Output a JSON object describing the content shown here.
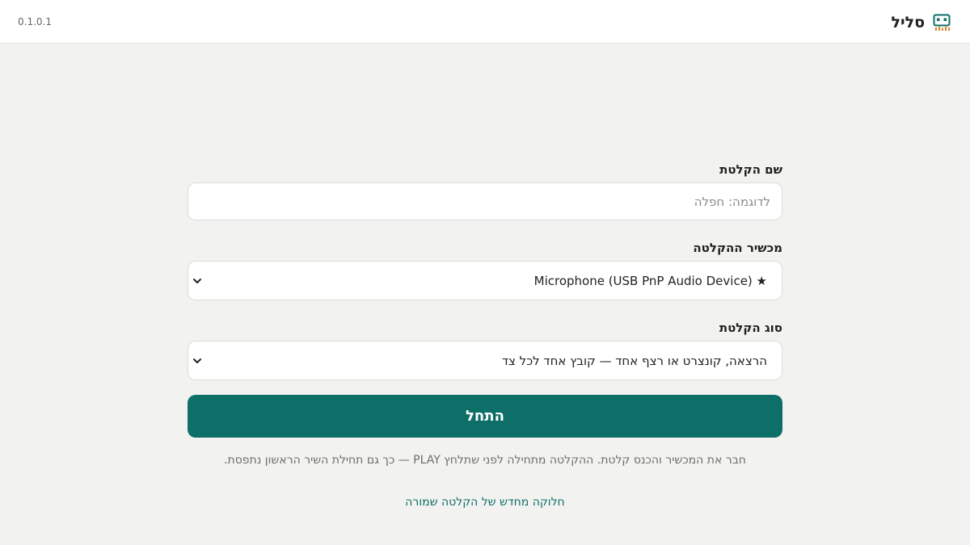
{
  "header": {
    "version": "0.1.0.1",
    "app_name": "סליל",
    "logo_icon": "cassette-icon",
    "accent_color": "#0e6e68",
    "logo_accent": "#d9822b"
  },
  "form": {
    "name_label": "שם הקלטת",
    "name_value": "",
    "name_placeholder": "לדוגמה: חפלה",
    "device_label": "מכשיר ההקלטה",
    "device_value": "★ Microphone (USB PnP Audio Device)",
    "type_label": "סוג הקלטת",
    "type_value": "הרצאה, קונצרט או רצף אחד — קובץ אחד לכל צד",
    "start_label": "התחל"
  },
  "hint_text": "חבר את המכשיר והכנס קלטת. ההקלטה מתחילה לפני שתלחץ PLAY — כך גם תחילת השיר הראשון נתפסת.",
  "reprocess_link": "חלוקה מחדש של הקלטה שמורה"
}
